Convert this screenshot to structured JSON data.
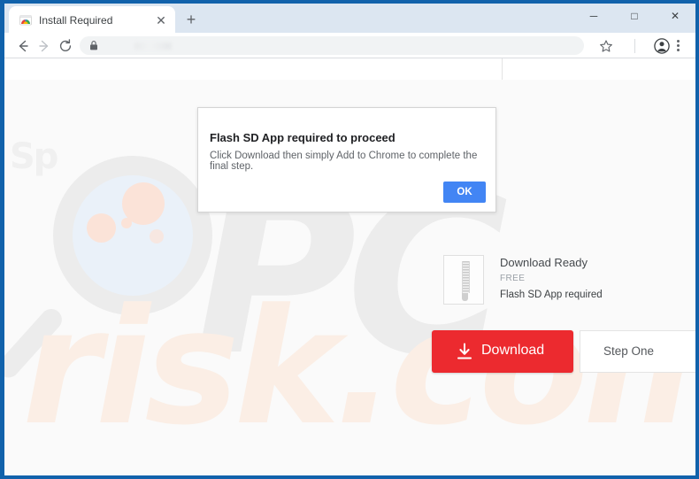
{
  "window": {
    "minimize_label": "─",
    "maximize_label": "□",
    "close_label": "✕"
  },
  "browser": {
    "tab": {
      "title": "Install Required",
      "favicon_name": "chrome-web-store-icon",
      "close_label": "✕"
    },
    "new_tab_label": "+",
    "toolbar": {
      "back_icon": "back-arrow-icon",
      "forward_icon": "forward-arrow-icon",
      "reload_icon": "reload-icon",
      "lock_icon": "lock-icon",
      "url_value": "",
      "url_placeholder": "",
      "star_icon": "star-icon",
      "profile_icon": "profile-avatar-icon",
      "menu_icon": "three-dot-menu-icon"
    }
  },
  "dialog": {
    "title": "Flash SD App required to proceed",
    "message": "Click Download then simply Add to Chrome to complete the final step.",
    "ok_label": "OK",
    "ok_color": "#4285f4"
  },
  "page": {
    "watermark": {
      "logo": "Sp",
      "big_text": "PC",
      "big_text_2": "risk.com",
      "glass_icon": "magnifying-glass-icon"
    },
    "download_info": {
      "icon_name": "zip-file-icon",
      "title": "Download Ready",
      "price": "FREE",
      "subtitle": "Flash SD App required"
    },
    "download_button": {
      "label": "Download",
      "icon_name": "download-arrow-icon",
      "color": "#ec2a2f"
    },
    "step_card": {
      "label": "Step One"
    }
  }
}
